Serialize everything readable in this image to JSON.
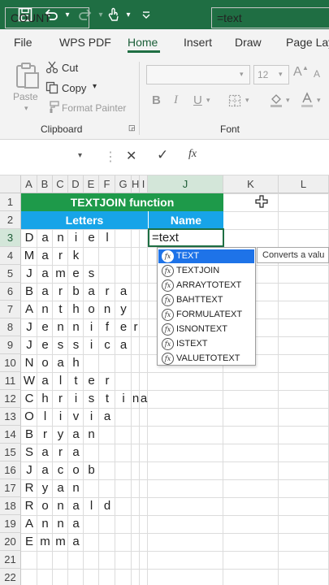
{
  "ribbon_tabs": [
    "File",
    "WPS PDF",
    "Home",
    "Insert",
    "Draw",
    "Page Lay"
  ],
  "clipboard": {
    "paste": "Paste",
    "cut": "Cut",
    "copy": "Copy",
    "format_painter": "Format Painter",
    "group_label": "Clipboard"
  },
  "font": {
    "size": "12",
    "bold": "B",
    "italic": "I",
    "underline": "U",
    "group_label": "Font",
    "grow": "A",
    "shrink": "A"
  },
  "formula_bar": {
    "name_box": "COUNT",
    "cancel": "✕",
    "enter": "✓",
    "fx": "fx",
    "formula": "=text"
  },
  "columns": [
    "A",
    "B",
    "C",
    "D",
    "E",
    "F",
    "G",
    "H",
    "I",
    "J",
    "K",
    "L"
  ],
  "rows": [
    "1",
    "2",
    "3",
    "4",
    "5",
    "6",
    "7",
    "8",
    "9",
    "10",
    "11",
    "12",
    "13",
    "14",
    "15",
    "16",
    "17",
    "18",
    "19",
    "20",
    "21",
    "22"
  ],
  "sheet": {
    "title": "TEXTJOIN function",
    "letters_header": "Letters",
    "name_header": "Name",
    "active_cell_value": "=text",
    "names": [
      [
        "D",
        "a",
        "n",
        "i",
        "e",
        "l"
      ],
      [
        "M",
        "a",
        "r",
        "k"
      ],
      [
        "J",
        "a",
        "m",
        "e",
        "s"
      ],
      [
        "B",
        "a",
        "r",
        "b",
        "a",
        "r",
        "a"
      ],
      [
        "A",
        "n",
        "t",
        "h",
        "o",
        "n",
        "y"
      ],
      [
        "J",
        "e",
        "n",
        "n",
        "i",
        "f",
        "e",
        "r"
      ],
      [
        "J",
        "e",
        "s",
        "s",
        "i",
        "c",
        "a"
      ],
      [
        "N",
        "o",
        "a",
        "h"
      ],
      [
        "W",
        "a",
        "l",
        "t",
        "e",
        "r"
      ],
      [
        "C",
        "h",
        "r",
        "i",
        "s",
        "t",
        "i",
        "n",
        "a"
      ],
      [
        "O",
        "l",
        "i",
        "v",
        "i",
        "a"
      ],
      [
        "B",
        "r",
        "y",
        "a",
        "n"
      ],
      [
        "S",
        "a",
        "r",
        "a"
      ],
      [
        "J",
        "a",
        "c",
        "o",
        "b"
      ],
      [
        "R",
        "y",
        "a",
        "n"
      ],
      [
        "R",
        "o",
        "n",
        "a",
        "l",
        "d"
      ],
      [
        "A",
        "n",
        "n",
        "a"
      ],
      [
        "E",
        "m",
        "m",
        "a"
      ]
    ]
  },
  "autocomplete": {
    "items": [
      "TEXT",
      "TEXTJOIN",
      "ARRAYTOTEXT",
      "BAHTTEXT",
      "FORMULATEXT",
      "ISNONTEXT",
      "ISTEXT",
      "VALUETOTEXT"
    ],
    "selected_index": 0,
    "tooltip": "Converts a valu"
  },
  "colors": {
    "title_green": "#1e9a4a",
    "header_blue": "#17a4e8",
    "excel_green": "#1f6e43",
    "selection_blue": "#1e73e8"
  }
}
